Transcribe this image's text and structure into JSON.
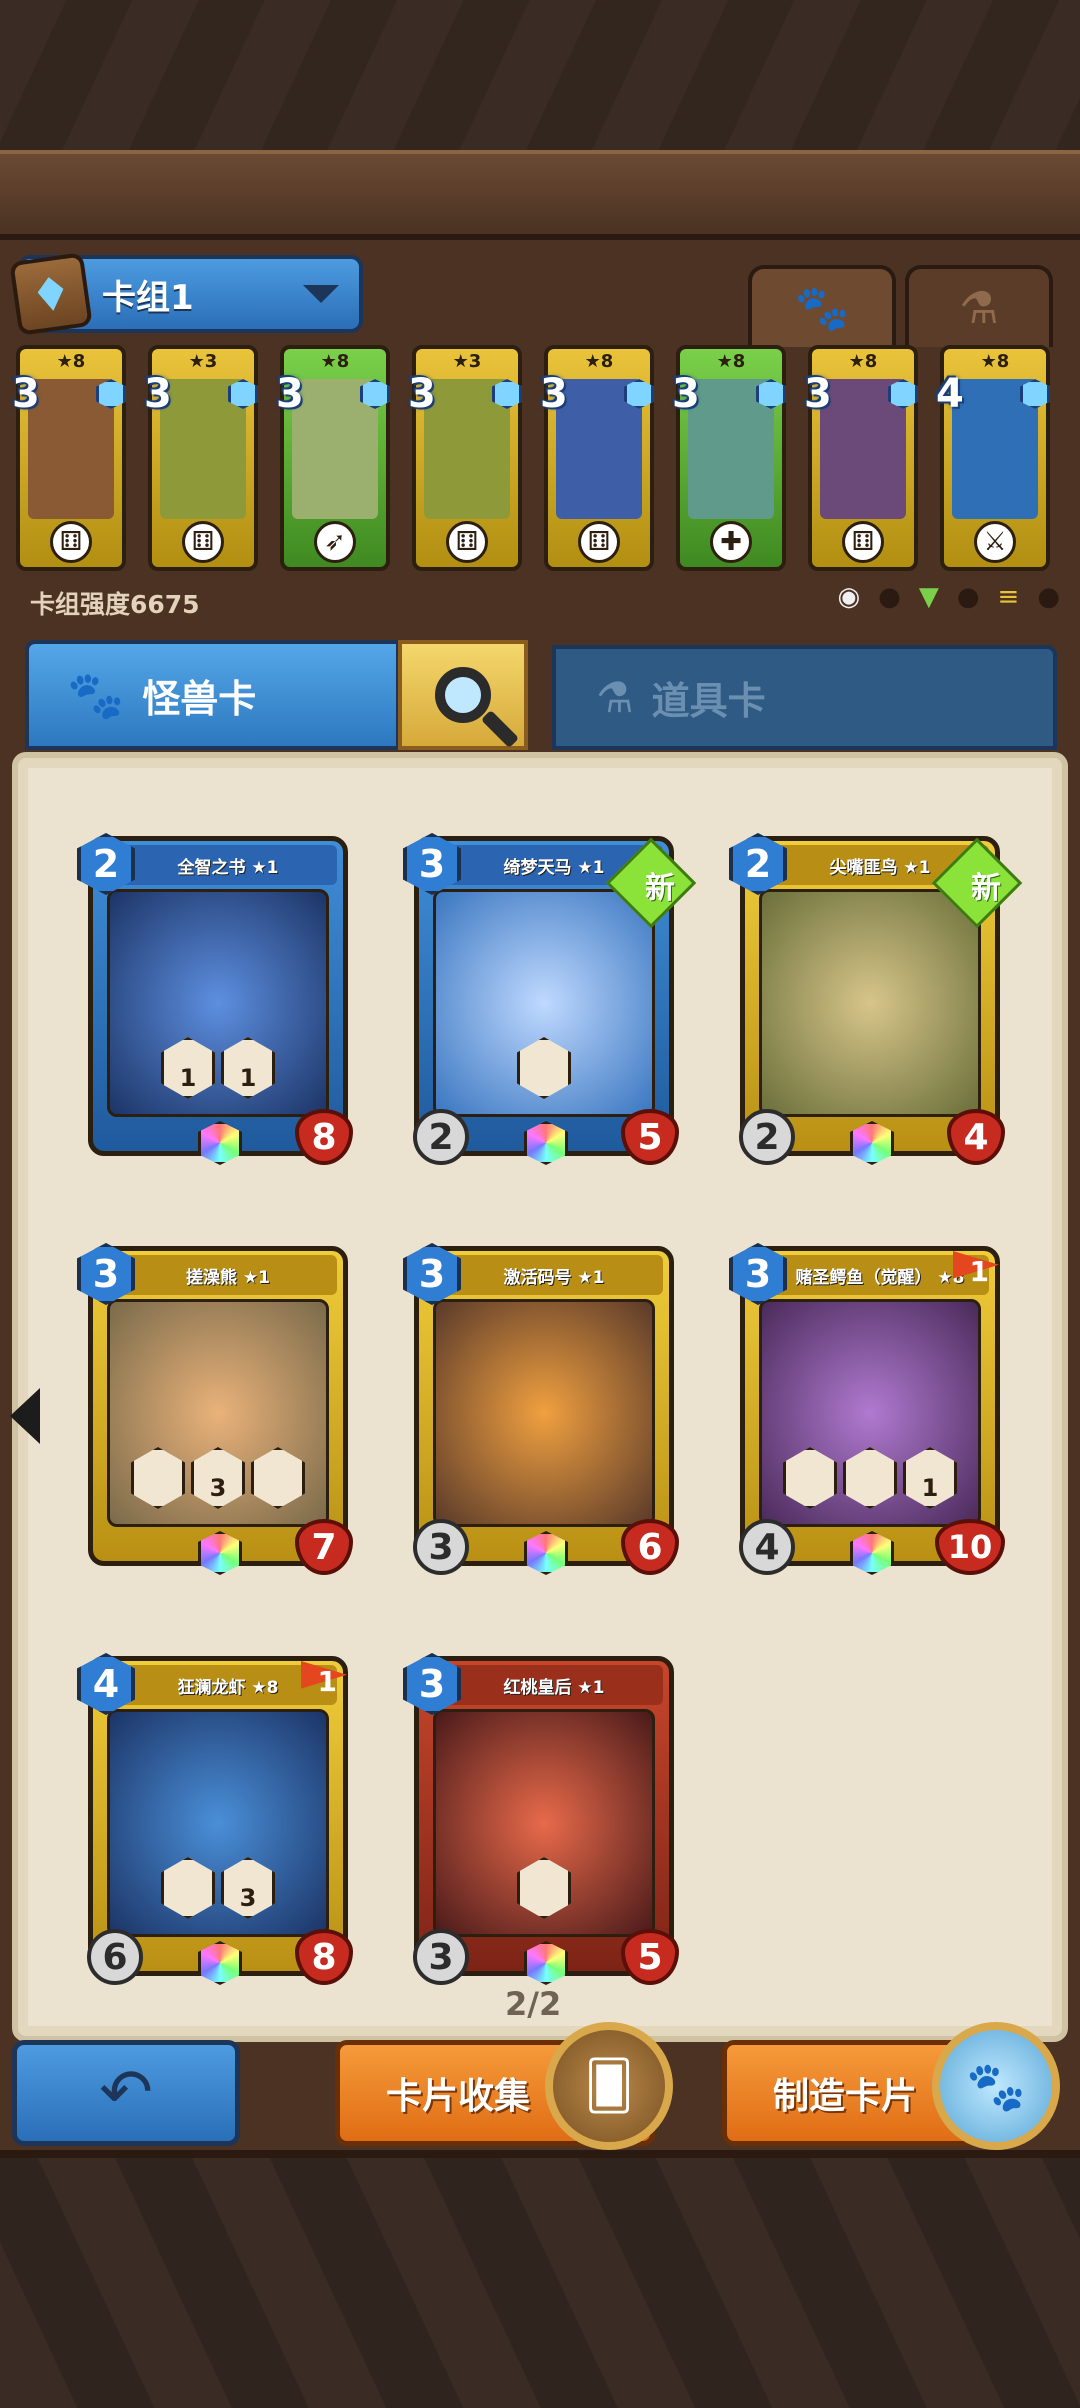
{
  "deck": {
    "name": "卡组1",
    "strength_label": "卡组强度6675",
    "type_tabs": [
      {
        "icon": "paw-icon",
        "active": true
      },
      {
        "icon": "flask-icon",
        "active": false
      }
    ],
    "cards": [
      {
        "stars": "★8",
        "cost": "3",
        "color": "gold"
      },
      {
        "stars": "★3",
        "cost": "3",
        "color": "gold"
      },
      {
        "stars": "★8",
        "cost": "3",
        "color": "green"
      },
      {
        "stars": "★3",
        "cost": "3",
        "color": "gold"
      },
      {
        "stars": "★8",
        "cost": "3",
        "color": "gold"
      },
      {
        "stars": "★8",
        "cost": "3",
        "color": "green"
      },
      {
        "stars": "★8",
        "cost": "3",
        "color": "gold"
      },
      {
        "stars": "★8",
        "cost": "4",
        "color": "gold"
      }
    ]
  },
  "tabs": {
    "monster_label": "怪兽卡",
    "item_label": "道具卡"
  },
  "collection": {
    "page": "2/2",
    "new_label": "新",
    "cards": [
      {
        "name": "全智之书 ★1",
        "cost": "2",
        "hp": "8",
        "skills": [
          "1",
          "1"
        ]
      },
      {
        "name": "绮梦天马 ★1",
        "cost": "3",
        "atk": "2",
        "hp": "5",
        "new": true
      },
      {
        "name": "尖嘴匪鸟 ★1",
        "cost": "2",
        "atk": "2",
        "hp": "4",
        "new": true
      },
      {
        "name": "搓澡熊 ★1",
        "cost": "3",
        "hp": "7",
        "skills": [
          "",
          "3",
          ""
        ]
      },
      {
        "name": "激活码号 ★1",
        "cost": "3",
        "atk": "3",
        "hp": "6"
      },
      {
        "name": "赌圣鳄鱼（觉醒） ★8",
        "cost": "3",
        "atk": "4",
        "hp": "10",
        "flag": "1",
        "skills": [
          "",
          "",
          "1"
        ]
      },
      {
        "name": "狂澜龙虾 ★8",
        "cost": "4",
        "atk": "6",
        "hp": "8",
        "flag": "1",
        "skills": [
          "",
          "3"
        ]
      },
      {
        "name": "红桃皇后 ★1",
        "cost": "3",
        "atk": "3",
        "hp": "5"
      }
    ]
  },
  "buttons": {
    "back_icon": "↶",
    "collect_label": "卡片收集",
    "craft_label": "制造卡片"
  },
  "colors": {
    "accent_blue": "#2d78bf",
    "accent_orange": "#e06d15",
    "panel_bg": "#ebe3cf"
  }
}
